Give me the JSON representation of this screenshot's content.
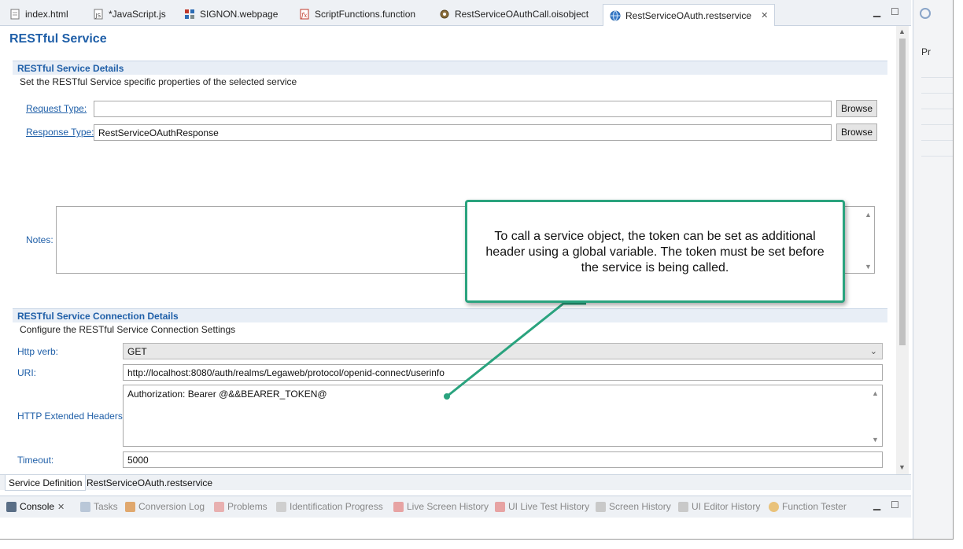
{
  "tabs": [
    {
      "label": "index.html",
      "icon": "html-file-icon"
    },
    {
      "label": "*JavaScript.js",
      "icon": "javascript-file-icon"
    },
    {
      "label": "SIGNON.webpage",
      "icon": "webpage-icon"
    },
    {
      "label": "ScriptFunctions.function",
      "icon": "function-icon"
    },
    {
      "label": "RestServiceOAuthCall.oisobject",
      "icon": "gear-icon"
    },
    {
      "label": "RestServiceOAuth.restservice",
      "icon": "globe-icon"
    }
  ],
  "right_panel": {
    "label": "Pr"
  },
  "page_title": "RESTful Service",
  "details": {
    "header": "RESTful Service Details",
    "description": "Set the RESTful Service specific properties of the selected service",
    "request_type_label": "Request Type:",
    "request_type_value": "",
    "response_type_label": "Response Type:",
    "response_type_value": "RestServiceOAuthResponse",
    "browse_label": "Browse",
    "notes_label": "Notes:",
    "notes_value": ""
  },
  "connection": {
    "header": "RESTful Service Connection Details",
    "description": "Configure the RESTful Service Connection Settings",
    "http_verb_label": "Http verb:",
    "http_verb_value": "GET",
    "uri_label": "URI:",
    "uri_value": "http://localhost:8080/auth/realms/Legaweb/protocol/openid-connect/userinfo",
    "headers_label": "HTTP Extended Headers:",
    "headers_value": "Authorization: Bearer @&&BEARER_TOKEN@",
    "timeout_label": "Timeout:",
    "timeout_value": "5000"
  },
  "bottom_tabs": [
    "Service Definition",
    "RestServiceOAuth.restservice"
  ],
  "console_tabs": [
    {
      "label": "Console",
      "icon": "console-icon",
      "active": true
    },
    {
      "label": "Tasks",
      "icon": "tasks-icon",
      "active": false
    },
    {
      "label": "Conversion Log",
      "icon": "conversion-log-icon",
      "active": false
    },
    {
      "label": "Problems",
      "icon": "problems-icon",
      "active": false
    },
    {
      "label": "Identification Progress",
      "icon": "identification-icon",
      "active": false
    },
    {
      "label": "Live Screen History",
      "icon": "live-screen-icon",
      "active": false
    },
    {
      "label": "UI Live Test History",
      "icon": "ui-live-test-icon",
      "active": false
    },
    {
      "label": "Screen History",
      "icon": "screen-history-icon",
      "active": false
    },
    {
      "label": "UI Editor History",
      "icon": "ui-editor-icon",
      "active": false
    },
    {
      "label": "Function Tester",
      "icon": "function-tester-icon",
      "active": false
    }
  ],
  "callout": {
    "text": "To call a service object, the token can be set as additional header using a global variable. The token must be set before the service is being called."
  },
  "colors": {
    "accent": "#1f5fa8",
    "callout_border": "#2aa37e"
  }
}
